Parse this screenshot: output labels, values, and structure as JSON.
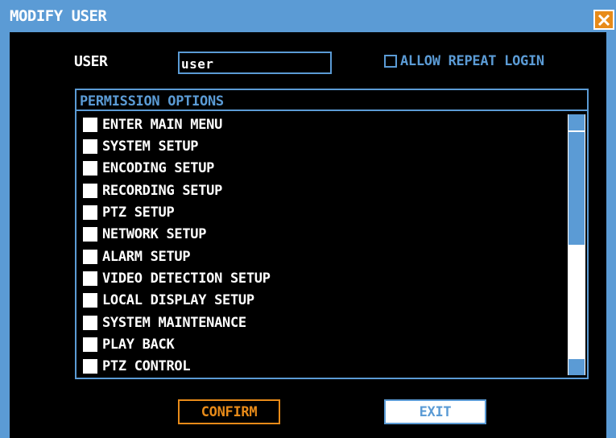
{
  "window": {
    "title": "MODIFY USER",
    "close_icon": "close-icon"
  },
  "user": {
    "label": "USER",
    "value": "user"
  },
  "allow_repeat_login": {
    "label": "ALLOW REPEAT LOGIN",
    "checked": false
  },
  "permissions": {
    "header": "PERMISSION OPTIONS",
    "items": [
      {
        "label": "ENTER MAIN MENU"
      },
      {
        "label": "SYSTEM SETUP"
      },
      {
        "label": "ENCODING SETUP"
      },
      {
        "label": "RECORDING SETUP"
      },
      {
        "label": "PTZ SETUP"
      },
      {
        "label": "NETWORK SETUP"
      },
      {
        "label": "ALARM SETUP"
      },
      {
        "label": "VIDEO DETECTION SETUP"
      },
      {
        "label": "LOCAL DISPLAY SETUP"
      },
      {
        "label": "SYSTEM MAINTENANCE"
      },
      {
        "label": "PLAY BACK"
      },
      {
        "label": "PTZ CONTROL"
      }
    ]
  },
  "buttons": {
    "confirm": "CONFIRM",
    "exit": "EXIT"
  },
  "colors": {
    "accent_blue": "#5b9bd5",
    "accent_orange": "#e88b19",
    "background": "#000000"
  }
}
